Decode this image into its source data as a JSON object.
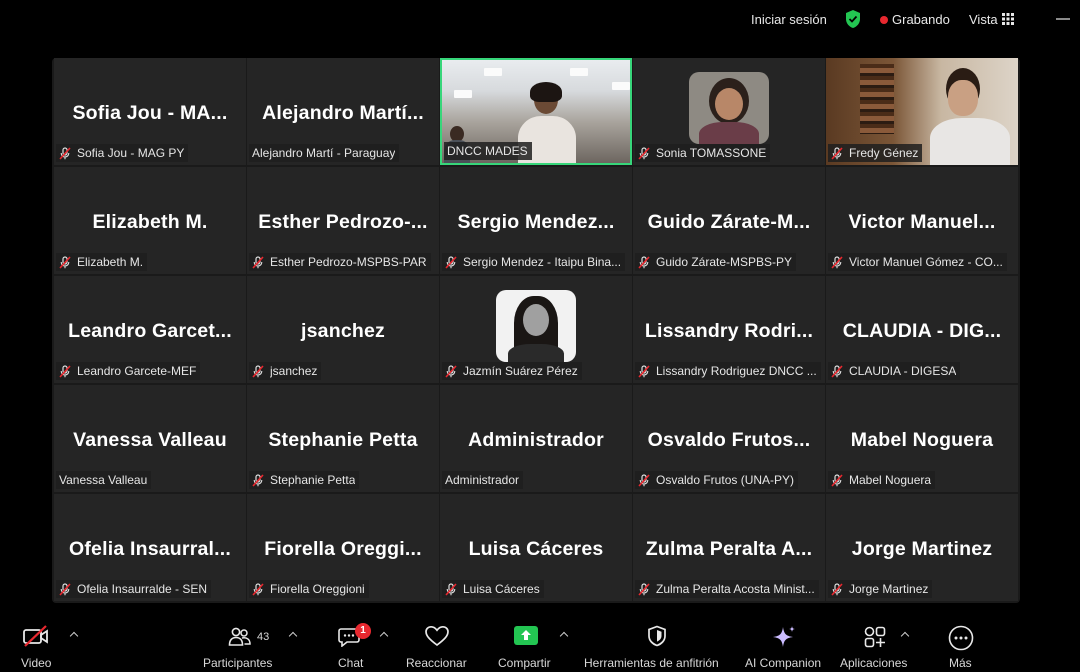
{
  "topbar": {
    "signin": "Iniciar sesión",
    "recording": "Grabando",
    "view": "Vista",
    "shield_color": "#23c552",
    "record_color": "#e8282f"
  },
  "gallery": {
    "active_border_color": "#37d67a",
    "tiles": [
      {
        "big": "Sofia Jou - MA...",
        "label": "Sofia Jou - MAG PY",
        "muted": true
      },
      {
        "big": "Alejandro Martí...",
        "label": "Alejandro Martí - Paraguay",
        "muted": false
      },
      {
        "big": "",
        "label": "DNCC MADES",
        "muted": false,
        "video": true
      },
      {
        "big": "",
        "label": "Sonia TOMASSONE",
        "muted": true,
        "video": true
      },
      {
        "big": "",
        "label": "Fredy Génez",
        "muted": true,
        "video": true
      },
      {
        "big": "Elizabeth M.",
        "label": "Elizabeth M.",
        "muted": true
      },
      {
        "big": "Esther Pedrozo-...",
        "label": "Esther Pedrozo-MSPBS-PAR",
        "muted": true
      },
      {
        "big": "Sergio Mendez...",
        "label": "Sergio Mendez - Itaipu Bina...",
        "muted": true
      },
      {
        "big": "Guido Zárate-M...",
        "label": "Guido Zárate-MSPBS-PY",
        "muted": true
      },
      {
        "big": "Victor Manuel...",
        "label": "Victor Manuel Gómez - CO...",
        "muted": true
      },
      {
        "big": "Leandro Garcet...",
        "label": "Leandro Garcete-MEF",
        "muted": true
      },
      {
        "big": "jsanchez",
        "label": "jsanchez",
        "muted": true
      },
      {
        "big": "",
        "label": "Jazmín Suárez Pérez",
        "muted": true,
        "video": true
      },
      {
        "big": "Lissandry Rodri...",
        "label": "Lissandry Rodriguez DNCC ...",
        "muted": true
      },
      {
        "big": "CLAUDIA - DIG...",
        "label": "CLAUDIA - DIGESA",
        "muted": true
      },
      {
        "big": "Vanessa Valleau",
        "label": "Vanessa Valleau",
        "muted": false
      },
      {
        "big": "Stephanie Petta",
        "label": "Stephanie Petta",
        "muted": true
      },
      {
        "big": "Administrador",
        "label": "Administrador",
        "muted": false
      },
      {
        "big": "Osvaldo Frutos...",
        "label": "Osvaldo Frutos (UNA-PY)",
        "muted": true
      },
      {
        "big": "Mabel Noguera",
        "label": "Mabel Noguera",
        "muted": true
      },
      {
        "big": "Ofelia Insaurral...",
        "label": "Ofelia Insaurralde - SEN",
        "muted": true
      },
      {
        "big": "Fiorella Oreggi...",
        "label": "Fiorella Oreggioni",
        "muted": true
      },
      {
        "big": "Luisa Cáceres",
        "label": "Luisa Cáceres",
        "muted": true
      },
      {
        "big": "Zulma Peralta A...",
        "label": "Zulma Peralta Acosta Minist...",
        "muted": true
      },
      {
        "big": "Jorge Martinez",
        "label": "Jorge Martinez",
        "muted": true
      }
    ]
  },
  "toolbar": {
    "video": "Video",
    "participants": "Participantes",
    "participants_count": "43",
    "chat": "Chat",
    "chat_badge": "1",
    "react": "Reaccionar",
    "share": "Compartir",
    "host_tools": "Herramientas de anfitrión",
    "ai": "AI Companion",
    "apps": "Aplicaciones",
    "more": "Más",
    "share_color": "#23c552",
    "video_off_color": "#e8282f"
  }
}
